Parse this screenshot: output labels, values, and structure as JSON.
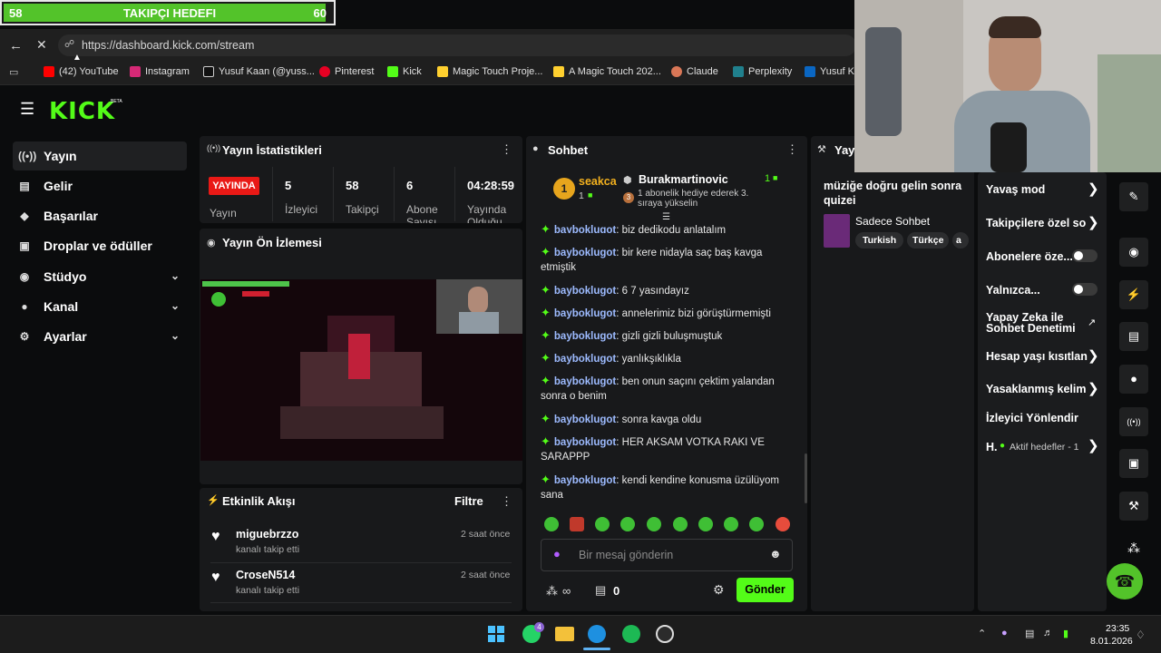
{
  "goal": {
    "current": "58",
    "title": "TAKIPÇI HEDEFI",
    "target": "60",
    "progress": 0.967
  },
  "browser": {
    "url": "https://dashboard.kick.com/stream"
  },
  "bookmarks": [
    "(42) YouTube",
    "Instagram",
    "Yusuf Kaan (@yuss...",
    "Pinterest",
    "Kick",
    "Magic Touch Proje...",
    "A Magic Touch 202...",
    "Claude",
    "Perplexity",
    "Yusuf Ka"
  ],
  "logo": "KICK",
  "logo_beta": "BETA",
  "sidebar": [
    "Yayın",
    "Gelir",
    "Başarılar",
    "Droplar ve ödüller",
    "Stüdyo",
    "Kanal",
    "Ayarlar"
  ],
  "stats": {
    "title": "Yayın İstatistikleri",
    "live_badge": "YAYINDA",
    "live_label": "Yayın",
    "items": [
      {
        "value": "5",
        "label": "İzleyici"
      },
      {
        "value": "58",
        "label": "Takipçi"
      },
      {
        "value": "6",
        "label": "Abone Sayısı"
      },
      {
        "value": "04:28:59",
        "label": "Yayında Olduğu"
      }
    ]
  },
  "preview": {
    "title": "Yayın Ön İzlemesi"
  },
  "activity": {
    "title": "Etkinlik Akışı",
    "filter": "Filtre",
    "items": [
      {
        "user": "miguebrzzo",
        "action": "kanalı takip etti",
        "time": "2 saat önce"
      },
      {
        "user": "CroseN514",
        "action": "kanalı takip etti",
        "time": "2 saat önce"
      }
    ]
  },
  "chat": {
    "title": "Sohbet",
    "pinned_user": "seakca",
    "pinned_count": "1",
    "gift_user": "Burakmartinovic",
    "gift_count": "1",
    "gift_text": "1 abonelik hediye ederek 3. sıraya yükselin",
    "gift_rank": "3",
    "partial_text": "biz dedikodu anlatalım",
    "messages": [
      {
        "user": "bayboklugot",
        "text": "bir kere nidayla saç baş kavga etmiştik"
      },
      {
        "user": "bayboklugot",
        "text": "6 7 yasındayız"
      },
      {
        "user": "bayboklugot",
        "text": "annelerimiz bizi görüştürmemişti"
      },
      {
        "user": "bayboklugot",
        "text": "gizli gizli buluşmuştuk"
      },
      {
        "user": "bayboklugot",
        "text": "yanlıkşıklıkla"
      },
      {
        "user": "bayboklugot",
        "text": "ben onun saçını çektim yalandan sonra o benim"
      },
      {
        "user": "bayboklugot",
        "text": "sonra kavga oldu"
      },
      {
        "user": "bayboklugot",
        "text": "HER AKSAM VOTKA RAKI VE SARAPPP"
      },
      {
        "user": "bayboklugot",
        "text": "kendi kendine konusma üzülüyom sana"
      }
    ],
    "input_placeholder": "Bir mesaj gönderin",
    "points": "0",
    "send": "Gönder"
  },
  "info": {
    "title_partial": "Yay",
    "stream_title": "müziğe doğru gelin sonra quizei",
    "category": "Sadece Sohbet",
    "tags": [
      "Turkish",
      "Türkçe",
      "a"
    ]
  },
  "chat_settings": [
    {
      "label": "Yavaş mod",
      "control": "chevron"
    },
    {
      "label": "Takipçilere özel so",
      "control": "chevron"
    },
    {
      "label": "Abonelere öze...",
      "control": "toggle"
    },
    {
      "label": "Yalnızca...",
      "control": "toggle"
    },
    {
      "label": "Yapay Zeka ile Sohbet Denetimi",
      "control": "external"
    },
    {
      "label": "Hesap yaşı kısıtlan",
      "control": "chevron"
    },
    {
      "label": "Yasaklanmış kelim",
      "control": "chevron"
    },
    {
      "label": "İzleyici Yönlendir",
      "control": "none"
    }
  ],
  "active_goals": {
    "label": "H.",
    "text": "Aktif hedefler - 1"
  },
  "taskbar": {
    "time": "23:35",
    "date": "8.01.2026",
    "whatsapp_badge": "4"
  },
  "colors": {
    "kick_green": "#53fc18",
    "live_red": "#e91916",
    "panel": "#18191b"
  }
}
